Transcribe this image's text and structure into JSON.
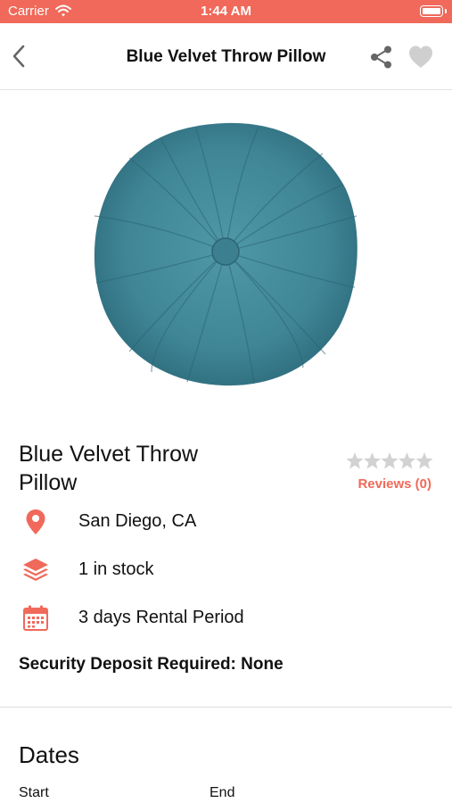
{
  "status_bar": {
    "carrier": "Carrier",
    "time": "1:44 AM"
  },
  "nav": {
    "title": "Blue Velvet Throw Pillow",
    "icons": [
      "back-chevron-icon",
      "share-icon",
      "heart-icon"
    ]
  },
  "product": {
    "name": "Blue Velvet Throw Pillow",
    "rating": 0,
    "rating_max": 5,
    "reviews_label": "Reviews (0)",
    "image": "round-blue-velvet-pillow"
  },
  "details": {
    "location": "San Diego, CA",
    "stock": "1 in stock",
    "rental_period": "3 days Rental Period",
    "deposit": "Security Deposit Required: None"
  },
  "dates": {
    "title": "Dates",
    "start_label": "Start",
    "end_label": "End"
  },
  "colors": {
    "accent": "#f0695a",
    "pillow": "#4a8fa0",
    "star_empty": "#d2d2d2"
  }
}
